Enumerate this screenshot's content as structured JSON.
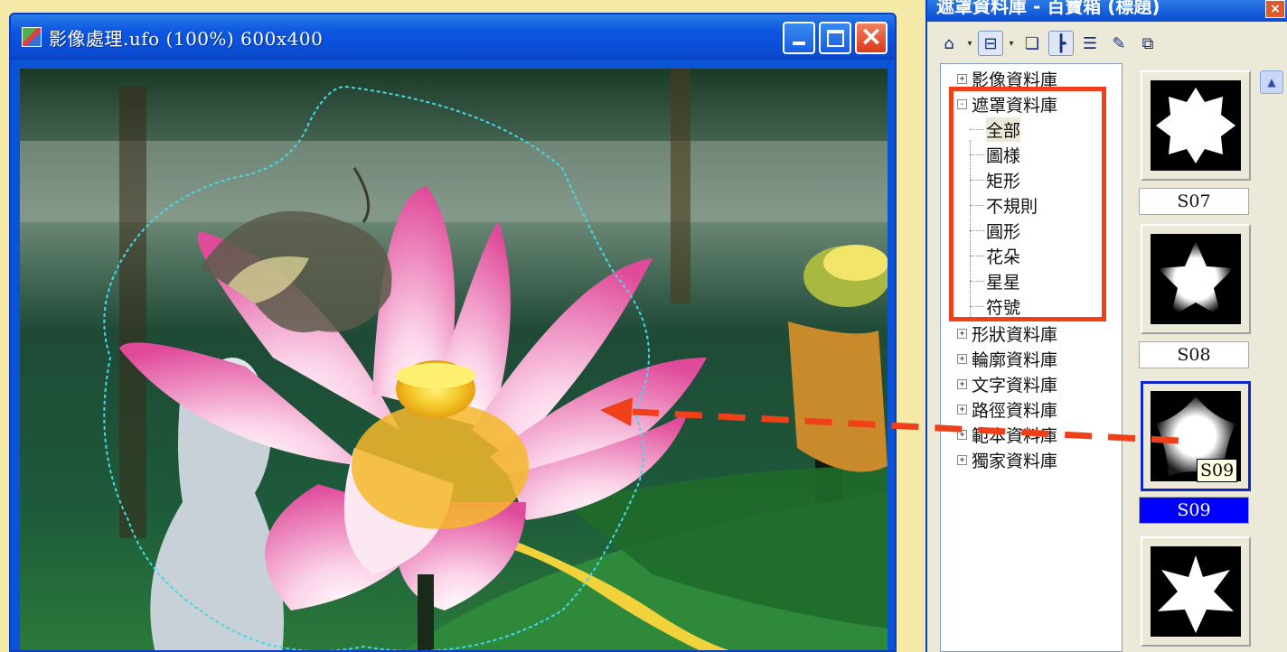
{
  "image_window": {
    "title": "影像處理.ufo (100%) 600x400",
    "icon": "app-image-icon",
    "buttons": {
      "minimize": "minimize-icon",
      "maximize": "maximize-icon",
      "close": "×"
    }
  },
  "library_window": {
    "title": "遮罩資料庫 - 百寶箱 (標題)",
    "close": "×",
    "toolbar": [
      "house-icon",
      "drive-icon",
      "cards-icon",
      "tree-icon",
      "list-icon",
      "edit-icon",
      "copy-icon"
    ],
    "tree": [
      {
        "label": "影像資料庫",
        "expander": "+",
        "level": 0
      },
      {
        "label": "遮罩資料庫",
        "expander": "-",
        "level": 0
      },
      {
        "label": "全部",
        "level": 1,
        "selected": true
      },
      {
        "label": "圖様",
        "level": 1
      },
      {
        "label": "矩形",
        "level": 1
      },
      {
        "label": "不規則",
        "level": 1
      },
      {
        "label": "圓形",
        "level": 1
      },
      {
        "label": "花朵",
        "level": 1
      },
      {
        "label": "星星",
        "level": 1
      },
      {
        "label": "符號",
        "level": 1
      },
      {
        "label": "形狀資料庫",
        "expander": "+",
        "level": 0
      },
      {
        "label": "輪廓資料庫",
        "expander": "+",
        "level": 0
      },
      {
        "label": "文字資料庫",
        "expander": "+",
        "level": 0
      },
      {
        "label": "路徑資料庫",
        "expander": "+",
        "level": 0
      },
      {
        "label": "範本資料庫",
        "expander": "+",
        "level": 0
      },
      {
        "label": "獨家資料庫",
        "expander": "+",
        "level": 0
      }
    ],
    "thumbnails": [
      {
        "label": "S07",
        "selected": false
      },
      {
        "label": "S08",
        "selected": false
      },
      {
        "label": "S09",
        "selected": true
      },
      {
        "label": "",
        "selected": false
      }
    ],
    "tooltip": "S09"
  },
  "colors": {
    "highlight": "#f0401a",
    "selection": "#0000ff",
    "titlebar": "#0a4bd0"
  }
}
